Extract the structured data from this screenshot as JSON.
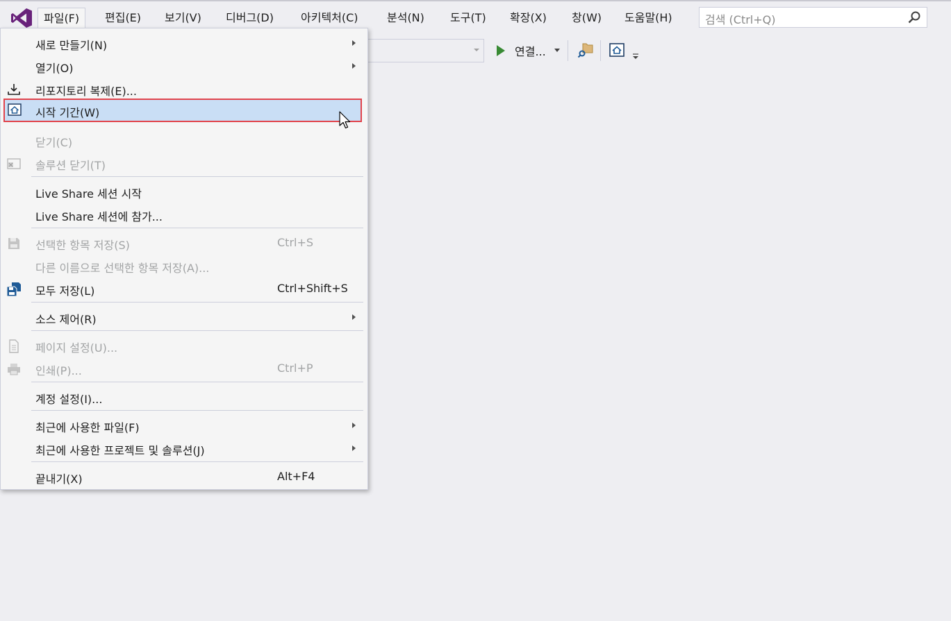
{
  "app": {
    "logo_icon": "visual-studio-logo-icon",
    "accent_color": "#68217a"
  },
  "menubar": {
    "items": [
      {
        "label": "파일(F)",
        "active": true
      },
      {
        "label": "편집(E)"
      },
      {
        "label": "보기(V)"
      },
      {
        "label": "디버그(D)"
      },
      {
        "label": "아키텍처(C)"
      },
      {
        "label": "분석(N)"
      },
      {
        "label": "도구(T)"
      },
      {
        "label": "확장(X)"
      },
      {
        "label": "창(W)"
      },
      {
        "label": "도움말(H)"
      }
    ],
    "search_placeholder": "검색 (Ctrl+Q)"
  },
  "toolbar": {
    "run_label": "연결..."
  },
  "file_menu": {
    "items": [
      {
        "label": "새로 만들기(N)",
        "submenu": true
      },
      {
        "label": "열기(O)",
        "submenu": true
      },
      {
        "label": "리포지토리 복제(E)...",
        "icon": "clone-download-icon"
      },
      {
        "label": "시작 기간(W)",
        "icon": "start-window-home-icon",
        "highlighted": true
      },
      {
        "label": "닫기(C)",
        "disabled": true
      },
      {
        "label": "솔루션 닫기(T)",
        "disabled": true,
        "icon": "close-solution-icon"
      },
      {
        "label": "Live Share 세션 시작"
      },
      {
        "label": "Live Share 세션에 참가..."
      },
      {
        "label": "선택한 항목 저장(S)",
        "shortcut": "Ctrl+S",
        "disabled": true,
        "icon": "save-icon"
      },
      {
        "label": "다른 이름으로 선택한 항목 저장(A)...",
        "disabled": true
      },
      {
        "label": "모두 저장(L)",
        "shortcut": "Ctrl+Shift+S",
        "icon": "save-all-icon"
      },
      {
        "label": "소스 제어(R)",
        "submenu": true
      },
      {
        "label": "페이지 설정(U)...",
        "disabled": true,
        "icon": "page-setup-icon"
      },
      {
        "label": "인쇄(P)...",
        "shortcut": "Ctrl+P",
        "disabled": true,
        "icon": "print-icon"
      },
      {
        "label": "계정 설정(I)..."
      },
      {
        "label": "최근에 사용한 파일(F)",
        "submenu": true
      },
      {
        "label": "최근에 사용한 프로젝트 및 솔루션(J)",
        "submenu": true
      },
      {
        "label": "끝내기(X)",
        "shortcut": "Alt+F4"
      }
    ]
  }
}
